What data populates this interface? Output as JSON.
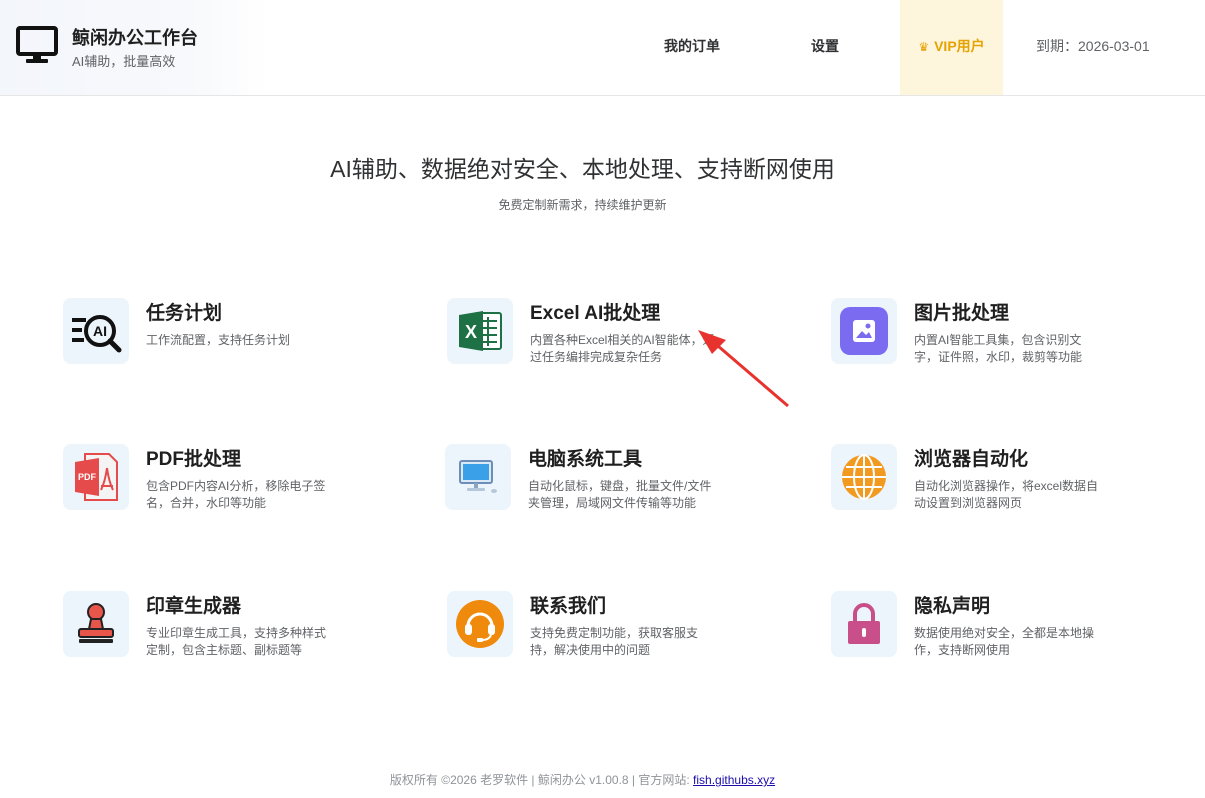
{
  "header": {
    "app_title": "鲸闲办公工作台",
    "app_subtitle": "AI辅助，批量高效",
    "nav": {
      "orders": "我的订单",
      "settings": "设置",
      "vip": "VIP用户"
    },
    "expiry": "到期：2026-03-01"
  },
  "hero": {
    "title": "AI辅助、数据绝对安全、本地处理、支持断网使用",
    "subtitle": "免费定制新需求，持续维护更新"
  },
  "cards": [
    {
      "title": "任务计划",
      "desc": "工作流配置，支持任务计划",
      "icon": "ai-search-icon"
    },
    {
      "title": "Excel AI批处理",
      "desc": "内置各种Excel相关的AI智能体，通过任务编排完成复杂任务",
      "icon": "excel-icon"
    },
    {
      "title": "图片批处理",
      "desc": "内置AI智能工具集，包含识别文字，证件照，水印，裁剪等功能",
      "icon": "image-icon"
    },
    {
      "title": "PDF批处理",
      "desc": "包含PDF内容AI分析，移除电子签名，合并，水印等功能",
      "icon": "pdf-icon"
    },
    {
      "title": "电脑系统工具",
      "desc": "自动化鼠标，键盘，批量文件/文件夹管理，局域网文件传输等功能",
      "icon": "computer-icon"
    },
    {
      "title": "浏览器自动化",
      "desc": "自动化浏览器操作，将excel数据自动设置到浏览器网页",
      "icon": "globe-icon"
    },
    {
      "title": "印章生成器",
      "desc": "专业印章生成工具，支持多种样式定制，包含主标题、副标题等",
      "icon": "stamp-icon"
    },
    {
      "title": "联系我们",
      "desc": "支持免费定制功能，获取客服支持，解决使用中的问题",
      "icon": "headset-icon"
    },
    {
      "title": "隐私声明",
      "desc": "数据使用绝对安全，全都是本地操作，支持断网使用",
      "icon": "lock-icon"
    }
  ],
  "footer": {
    "text": "版权所有 ©2026 老罗软件 | 鲸闲办公 v1.00.8 | 官方网站: ",
    "link": "fish.githubs.xyz"
  },
  "colors": {
    "vip": "#e6a200",
    "vip_bg": "#fdf6dc",
    "icon_bg": "#ecf4fc",
    "arrow": "#e8322d"
  }
}
